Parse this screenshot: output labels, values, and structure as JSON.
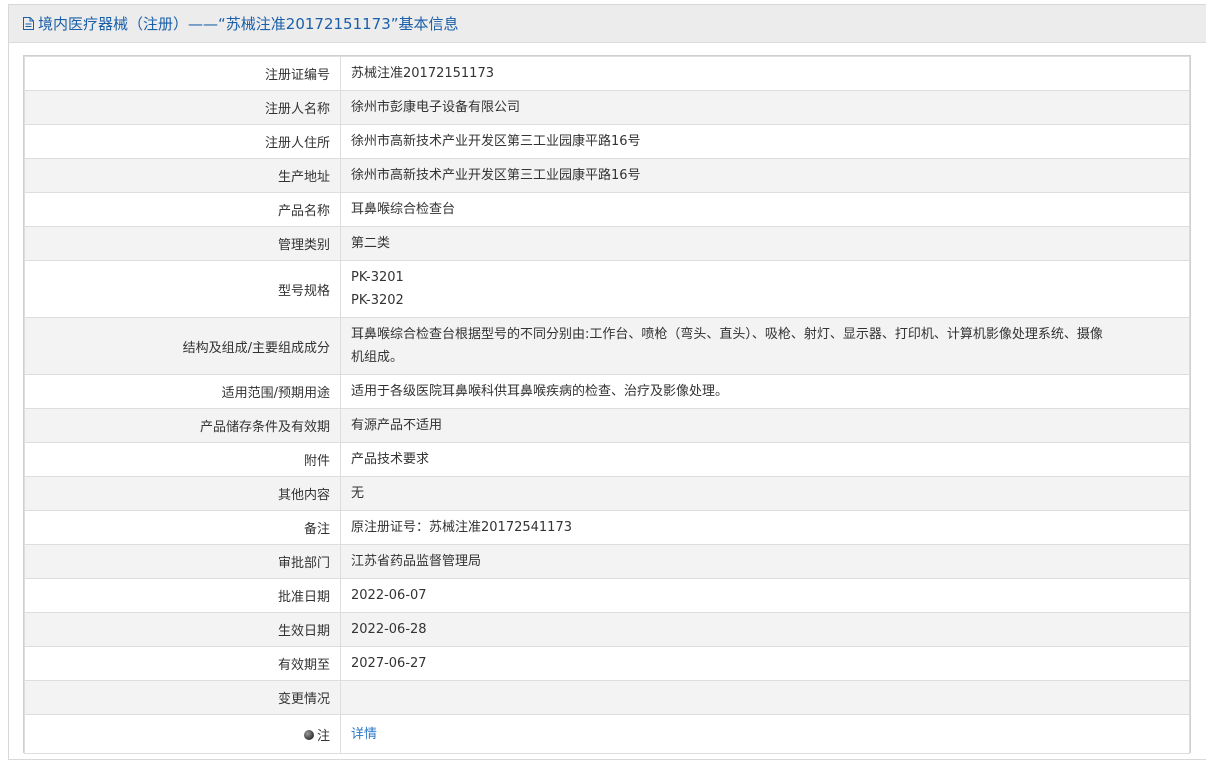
{
  "header": {
    "title": "境内医疗器械（注册）——“苏械注准20172151173”基本信息",
    "icon": "document-icon"
  },
  "colors": {
    "title_blue": "#1a5fa8",
    "link_blue": "#2a77c9",
    "stripe_gray": "#f3f3f3",
    "header_gray": "#ececec"
  },
  "rows": [
    {
      "label": "注册证编号",
      "value": "苏械注准20172151173"
    },
    {
      "label": "注册人名称",
      "value": "徐州市彭康电子设备有限公司"
    },
    {
      "label": "注册人住所",
      "value": "徐州市高新技术产业开发区第三工业园康平路16号"
    },
    {
      "label": "生产地址",
      "value": "徐州市高新技术产业开发区第三工业园康平路16号"
    },
    {
      "label": "产品名称",
      "value": "耳鼻喉综合检查台"
    },
    {
      "label": "管理类别",
      "value": "第二类"
    },
    {
      "label": "型号规格",
      "value_lines": [
        "PK-3201",
        "PK-3202"
      ]
    },
    {
      "label": "结构及组成/主要组成成分",
      "value_lines": [
        "耳鼻喉综合检查台根据型号的不同分别由:工作台、喷枪（弯头、直头）、吸枪、射灯、显示器、打印机、计算机影像处理系统、摄像",
        "机组成。"
      ]
    },
    {
      "label": "适用范围/预期用途",
      "value": "适用于各级医院耳鼻喉科供耳鼻喉疾病的检查、治疗及影像处理。"
    },
    {
      "label": "产品储存条件及有效期",
      "value": "有源产品不适用"
    },
    {
      "label": "附件",
      "value": "产品技术要求"
    },
    {
      "label": "其他内容",
      "value": "无"
    },
    {
      "label": "备注",
      "value": "原注册证号：苏械注准20172541173"
    },
    {
      "label": "审批部门",
      "value": "江苏省药品监督管理局"
    },
    {
      "label": "批准日期",
      "value": "2022-06-07"
    },
    {
      "label": "生效日期",
      "value": "2022-06-28"
    },
    {
      "label": "有效期至",
      "value": "2027-06-27"
    },
    {
      "label": "变更情况",
      "value": ""
    },
    {
      "label": "注",
      "value": "详情",
      "icon": "note-icon"
    }
  ]
}
